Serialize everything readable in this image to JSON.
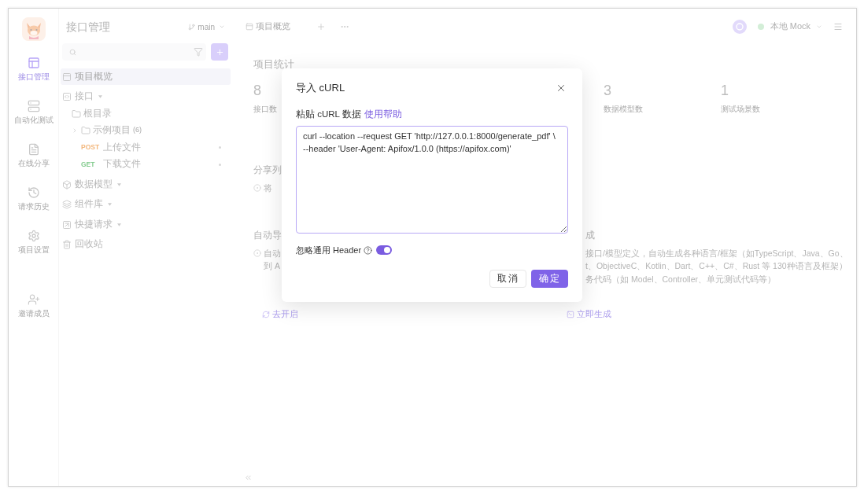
{
  "rail": {
    "items": [
      {
        "label": "接口管理",
        "selected": true
      },
      {
        "label": "自动化测试",
        "selected": false
      },
      {
        "label": "在线分享",
        "selected": false
      },
      {
        "label": "请求历史",
        "selected": false
      },
      {
        "label": "项目设置",
        "selected": false
      }
    ],
    "invite": {
      "label": "邀请成员"
    }
  },
  "sidebar": {
    "title": "接口管理",
    "branch": "main",
    "tree": [
      {
        "kind": "page",
        "label": "项目概览",
        "selected": true
      },
      {
        "kind": "section",
        "label": "接口",
        "selected": false,
        "children": [
          {
            "kind": "root",
            "label": "根目录",
            "selected": false,
            "children": [
              {
                "kind": "folder",
                "label": "示例项目",
                "count": "(6)",
                "expanded": false,
                "selected": false
              },
              {
                "kind": "request",
                "method": "POST",
                "color": "#f3b77d",
                "label": "上传文件",
                "selected": false
              },
              {
                "kind": "request",
                "method": "GET",
                "color": "#86cc91",
                "label": "下载文件",
                "selected": false
              }
            ]
          }
        ]
      },
      {
        "kind": "section",
        "label": "数据模型",
        "selected": false
      },
      {
        "kind": "section",
        "label": "组件库",
        "selected": false
      },
      {
        "kind": "section",
        "label": "快捷请求",
        "selected": false
      },
      {
        "kind": "page",
        "label": "回收站",
        "selected": false
      }
    ]
  },
  "tabs": [
    {
      "label": "项目概览",
      "selected": true
    }
  ],
  "environment": {
    "label": "本地 Mock"
  },
  "overview": {
    "title": "项目统计",
    "stats": [
      {
        "value": "8",
        "label": "接口数"
      },
      {
        "value": "3",
        "label": "数据模型数"
      },
      {
        "value": "1",
        "label": "测试场景数"
      }
    ],
    "feature_rows": [
      {
        "cards": [
          {
            "title": "分享列",
            "lines": [
              "将"
            ]
          }
        ]
      },
      {
        "cards": [
          {
            "title": "自动导",
            "lines": [
              "自动",
              "到 A"
            ],
            "action": "去开启"
          },
          {
            "title": "成",
            "lines": [
              "接口/模型定义，自动生成各种语言/框架（如TypeScript、Java、Go、",
              "t、ObjectiveC、Kotlin、Dart、C++、C#、Rust 等 130种语言及框架）",
              "务代码（如 Model、Controller、单元测试代码等）"
            ],
            "action": "立即生成"
          }
        ]
      }
    ]
  },
  "dialog": {
    "title": "导入 cURL",
    "field_label": "粘贴 cURL 数据",
    "help_link": "使用帮助",
    "value": "curl --location --request GET 'http://127.0.0.1:8000/generate_pdf' \\\n--header 'User-Agent: Apifox/1.0.0 (https://apifox.com)'",
    "option": {
      "label": "忽略通用 Header",
      "on": true
    },
    "buttons": [
      {
        "label": "取消",
        "kind": "secondary"
      },
      {
        "label": "确定",
        "kind": "primary"
      }
    ]
  }
}
